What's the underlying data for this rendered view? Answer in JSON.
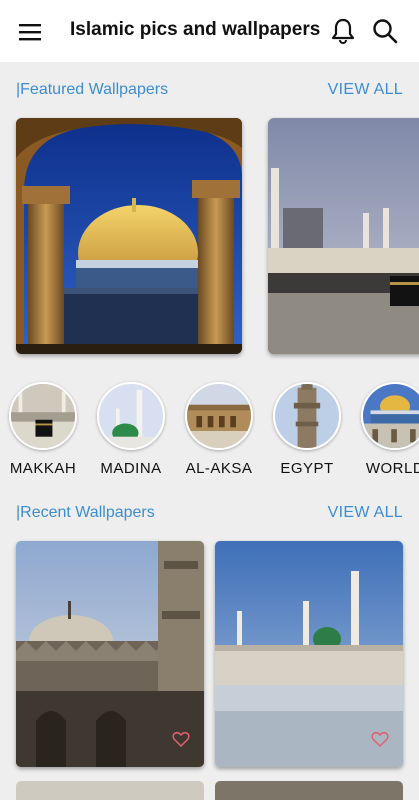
{
  "appbar": {
    "title": "Islamic pics and wallpapers",
    "menu_icon": "hamburger-menu-icon",
    "notifications_icon": "bell-icon",
    "search_icon": "search-icon"
  },
  "featured": {
    "label": "|Featured Wallpapers",
    "view_all": "VIEW ALL"
  },
  "categories": [
    {
      "name": "MAKKAH"
    },
    {
      "name": "MADINA"
    },
    {
      "name": "AL-AKSA"
    },
    {
      "name": "EGYPT"
    },
    {
      "name": "WORLD"
    }
  ],
  "recent": {
    "label": "|Recent Wallpapers",
    "view_all": "VIEW ALL"
  },
  "colors": {
    "accent": "#3c8dd4",
    "background": "#eeeeee",
    "heart": "#e06070"
  }
}
